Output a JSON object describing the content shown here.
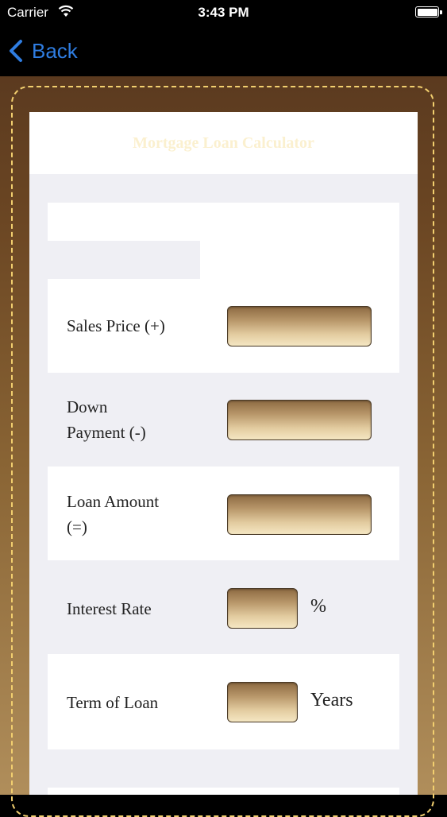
{
  "status_bar": {
    "carrier": "Carrier",
    "time": "3:43 PM"
  },
  "nav": {
    "back_label": "Back"
  },
  "title": "Mortgage Loan Calculator",
  "fields": {
    "sales_price": {
      "label": "Sales Price (+)",
      "value": ""
    },
    "down_payment": {
      "label_line1": "Down",
      "label_line2": "Payment (-)",
      "value": ""
    },
    "loan_amount": {
      "label_line1": "Loan Amount",
      "label_line2": "(=)",
      "value": ""
    },
    "interest_rate": {
      "label": "Interest Rate",
      "value": "",
      "unit": "%"
    },
    "term_of_loan": {
      "label": "Term of Loan",
      "value": "",
      "unit": "Years"
    }
  },
  "colors": {
    "accent": "#2f7de1",
    "stitch": "#f2cf6f",
    "frame_top": "#5b3a1f",
    "frame_bottom": "#b08e5b",
    "panel": "#efeff4",
    "title_text": "#fbf0cf"
  }
}
